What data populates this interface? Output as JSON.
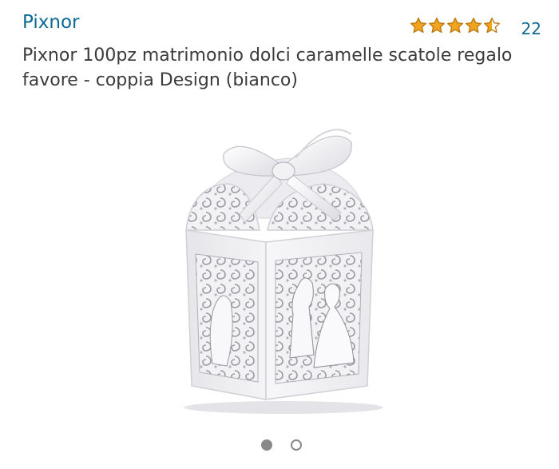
{
  "brand": {
    "name": "Pixnor"
  },
  "rating": {
    "stars": 4.5,
    "max_stars": 5,
    "review_count": "22",
    "star_color": "#f0a41f",
    "star_outline": "#b9770e"
  },
  "product": {
    "title": "Pixnor 100pz matrimonio dolci caramelle scatole regalo favore - coppia Design (bianco)",
    "image_icon": "gift-box-image"
  },
  "carousel": {
    "total": 2,
    "active_index": 0
  },
  "colors": {
    "link": "#0c6b96",
    "text": "#3b3b3b",
    "dot": "#888888"
  }
}
